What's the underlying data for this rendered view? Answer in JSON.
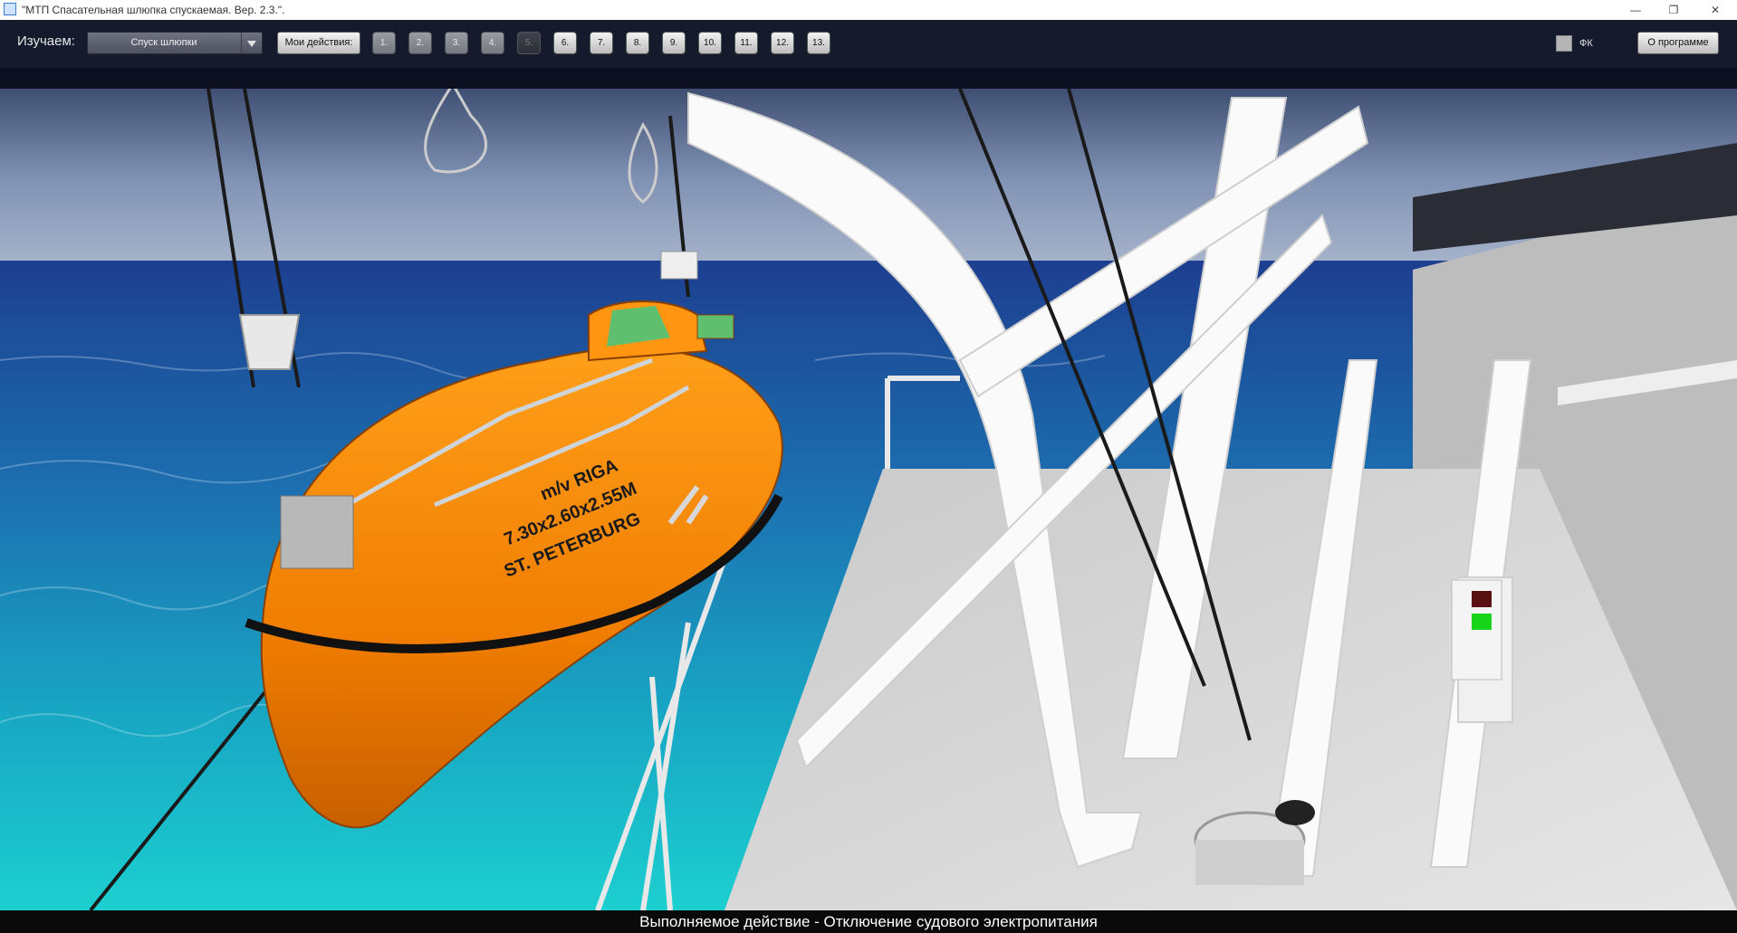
{
  "window": {
    "title": "\"МТП Спасательная шлюпка спускаемая. Вер. 2.3.\".",
    "minimize_glyph": "—",
    "maximize_glyph": "❐",
    "close_glyph": "✕"
  },
  "toolbar": {
    "study_label": "Изучаем:",
    "study_select_value": "Спуск шлюпки",
    "my_actions_label": "Мои действия:",
    "steps": [
      "1.",
      "2.",
      "3.",
      "4.",
      "5.",
      "6.",
      "7.",
      "8.",
      "9.",
      "10.",
      "11.",
      "12.",
      "13."
    ],
    "fk_label": "ФК",
    "about_label": "О программе"
  },
  "scene": {
    "boat_text_line1": "m/v RIGA",
    "boat_text_line2": "7.30x2.60x2.55M",
    "boat_text_line3": "ST. PETERBURG",
    "boat_color": "#ff8a00",
    "sea_color": "#1f8fc0",
    "sky_color": "#6d83a8"
  },
  "status": {
    "text": "Выполняемое действие - Отключение судового электропитания"
  }
}
